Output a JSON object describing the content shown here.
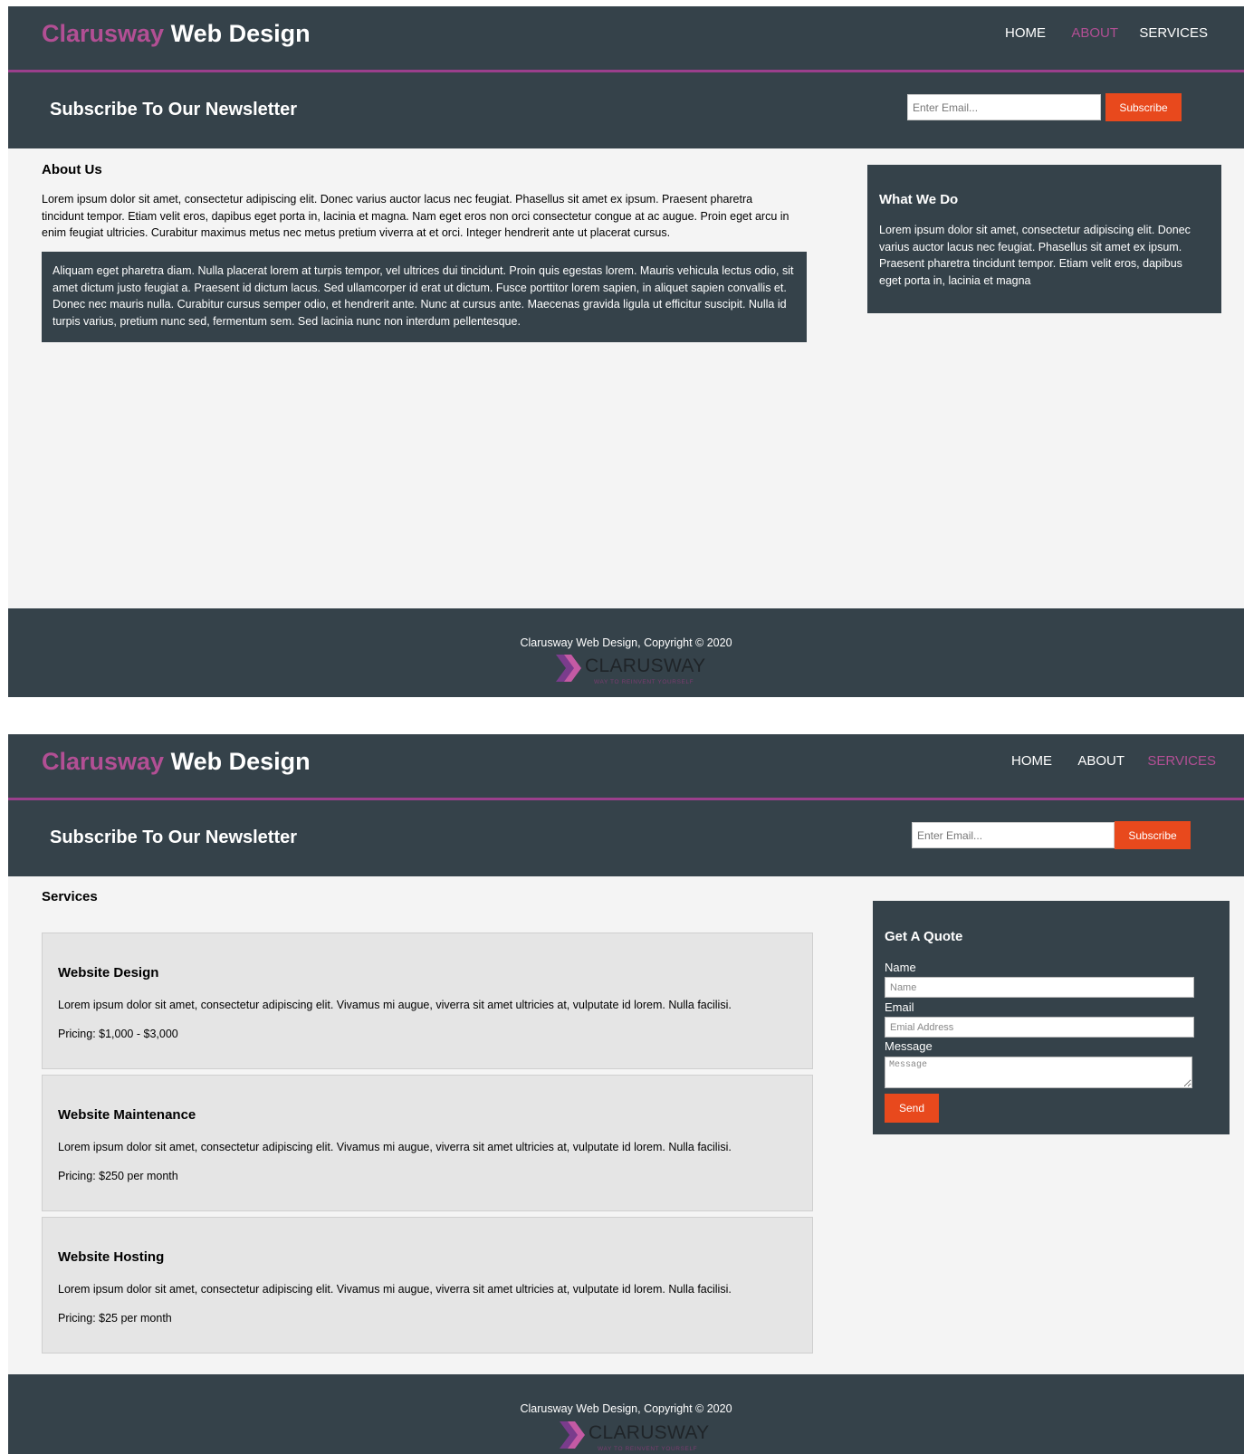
{
  "about_page": {
    "header": {
      "logo_accent": "Clarusway",
      "logo_rest": " Web Design",
      "nav": {
        "home": "HOME",
        "about": "ABOUT",
        "services": "SERVICES"
      },
      "active_nav": "ABOUT"
    },
    "newsletter": {
      "title": "Subscribe To Our Newsletter",
      "email_placeholder": "Enter Email...",
      "subscribe_label": "Subscribe"
    },
    "main": {
      "title": "About Us",
      "paragraph": "Lorem ipsum dolor sit amet, consectetur adipiscing elit. Donec varius auctor lacus nec feugiat. Phasellus sit amet ex ipsum. Praesent pharetra tincidunt tempor. Etiam velit eros, dapibus eget porta in, lacinia et magna. Nam eget eros non orci consectetur congue at ac augue. Proin eget arcu in enim feugiat ultricies. Curabitur maximus metus nec metus pretium viverra at et orci. Integer hendrerit ante ut placerat cursus.",
      "dark_paragraph": "Aliquam eget pharetra diam. Nulla placerat lorem at turpis tempor, vel ultrices dui tincidunt. Proin quis egestas lorem. Mauris vehicula lectus odio, sit amet dictum justo feugiat a. Praesent id dictum lacus. Sed ullamcorper id erat ut dictum. Fusce porttitor lorem sapien, in aliquet sapien convallis et. Donec nec mauris nulla. Curabitur cursus semper odio, et hendrerit ante. Nunc at cursus ante. Maecenas gravida ligula ut efficitur suscipit. Nulla id turpis varius, pretium nunc sed, fermentum sem. Sed lacinia nunc non interdum pellentesque."
    },
    "sidebar": {
      "title": "What We Do",
      "text": "Lorem ipsum dolor sit amet, consectetur adipiscing elit. Donec varius auctor lacus nec feugiat. Phasellus sit amet ex ipsum. Praesent pharetra tincidunt tempor. Etiam velit eros, dapibus eget porta in, lacinia et magna"
    },
    "footer": {
      "copyright": "Clarusway Web Design, Copyright © 2020",
      "brand_name": "CLARUSWAY",
      "brand_tagline": "WAY TO REINVENT YOURSELF"
    }
  },
  "services_page": {
    "header": {
      "logo_accent": "Clarusway",
      "logo_rest": " Web Design",
      "nav": {
        "home": "HOME",
        "about": "ABOUT",
        "services": "SERVICES"
      },
      "active_nav": "SERVICES"
    },
    "newsletter": {
      "title": "Subscribe To Our Newsletter",
      "email_placeholder": "Enter Email...",
      "subscribe_label": "Subscribe"
    },
    "main": {
      "title": "Services",
      "services": [
        {
          "name": "Website Design",
          "description": "Lorem ipsum dolor sit amet, consectetur adipiscing elit. Vivamus mi augue, viverra sit amet ultricies at, vulputate id lorem. Nulla facilisi.",
          "pricing": "Pricing: $1,000 - $3,000"
        },
        {
          "name": "Website Maintenance",
          "description": "Lorem ipsum dolor sit amet, consectetur adipiscing elit. Vivamus mi augue, viverra sit amet ultricies at, vulputate id lorem. Nulla facilisi.",
          "pricing": "Pricing: $250 per month"
        },
        {
          "name": "Website Hosting",
          "description": "Lorem ipsum dolor sit amet, consectetur adipiscing elit. Vivamus mi augue, viverra sit amet ultricies at, vulputate id lorem. Nulla facilisi.",
          "pricing": "Pricing: $25 per month"
        }
      ]
    },
    "quote": {
      "title": "Get A Quote",
      "name_label": "Name",
      "name_placeholder": "Name",
      "email_label": "Email",
      "email_placeholder": "Emial Address",
      "message_label": "Message",
      "message_placeholder": "Message",
      "send_label": "Send"
    },
    "footer": {
      "copyright": "Clarusway Web Design, Copyright © 2020",
      "brand_name": "CLARUSWAY",
      "brand_tagline": "WAY TO REINVENT YOURSELF"
    }
  },
  "colors": {
    "dark": "#35424a",
    "accent_purple": "#b24f94",
    "accent_orange": "#e8491d",
    "background": "#f4f4f4",
    "service_card": "#e5e5e5"
  }
}
